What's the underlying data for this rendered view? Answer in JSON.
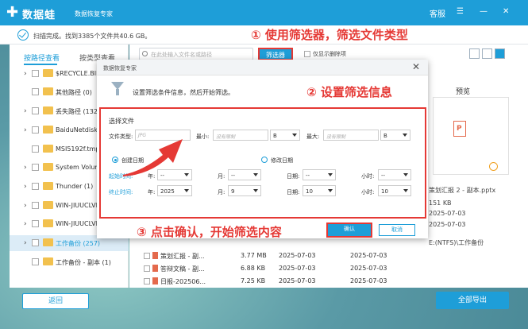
{
  "app": {
    "logo_text": "数据蛙",
    "subtitle": "数据恢复专家",
    "support": "客服",
    "menu_icon": "☰",
    "minimize": "—",
    "close": "✕"
  },
  "scan": {
    "status": "扫描完成。找到3385个文件共40.6 GB。"
  },
  "tabs": {
    "path_view": "按路径查看",
    "type_view": "按类型查看"
  },
  "tree": [
    {
      "label": "$RECYCLE.BIN",
      "chev": "›"
    },
    {
      "label": "其他路径 (0)",
      "chev": ""
    },
    {
      "label": "丢失路径 (132",
      "chev": "›"
    },
    {
      "label": "BaiduNetdisk (",
      "chev": "›"
    },
    {
      "label": "MSI5192f.tmp",
      "chev": ""
    },
    {
      "label": "System Volum",
      "chev": "›"
    },
    {
      "label": "Thunder (1)",
      "chev": "›"
    },
    {
      "label": "WIN-JIUUCLVI",
      "chev": "›"
    },
    {
      "label": "WIN-JIUUCLVI",
      "chev": "›"
    },
    {
      "label": "工作备份 (257)",
      "chev": "›"
    },
    {
      "label": "工作备份 - 副本 (1)",
      "chev": ""
    }
  ],
  "search": {
    "placeholder": "在此处输入文件名或路径"
  },
  "toolbar": {
    "filter_label": "筛选器",
    "show_deleted": "仅显示删除项"
  },
  "preview": {
    "title": "预览",
    "filename": "策划汇报 2 - 副本.pptx",
    "size": "151 KB",
    "created": "2025-07-03",
    "modified": "2025-07-03",
    "path": "E:(NTFS)\\工作备份"
  },
  "files": [
    {
      "name": "策划汇报 - 副...",
      "size": "3.77 MB",
      "date1": "2025-07-03",
      "date2": "2025-07-03"
    },
    {
      "name": "答辩文稿 - 副...",
      "size": "6.88 KB",
      "date1": "2025-07-03",
      "date2": "2025-07-03"
    },
    {
      "name": "日报-202506...",
      "size": "7.25 KB",
      "date1": "2025-07-03",
      "date2": "2025-07-03"
    }
  ],
  "bottom": {
    "back": "返回",
    "export_all": "全部导出"
  },
  "modal": {
    "title": "数据恢复专家",
    "close": "✕",
    "description": "设置筛选条件信息，然后开始筛选。",
    "section": "选择文件",
    "file_type_label": "文件类型:",
    "file_type_placeholder": "JPG",
    "min_label": "最小:",
    "min_placeholder": "没有限制",
    "min_unit": "B",
    "max_label": "最大:",
    "max_placeholder": "没有限制",
    "max_unit": "B",
    "created_date": "创建日期",
    "modified_date": "修改日期",
    "start_time": "起始时间:",
    "end_time": "终止时间:",
    "year_label": "年:",
    "month_label": "月:",
    "day_label": "日期:",
    "hour_label": "小时:",
    "start": {
      "year": "--",
      "month": "--",
      "day": "--",
      "hour": "--"
    },
    "end": {
      "year": "2025",
      "month": "9",
      "day": "10",
      "hour": "10"
    },
    "confirm": "确认",
    "cancel": "取消"
  },
  "annotations": {
    "step1": "① 使用筛选器，筛选文件类型",
    "step2": "② 设置筛选信息",
    "step3": "③ 点击确认，开始筛选内容"
  },
  "colors": {
    "accent": "#1e9ed8",
    "highlight": "#e53935"
  }
}
